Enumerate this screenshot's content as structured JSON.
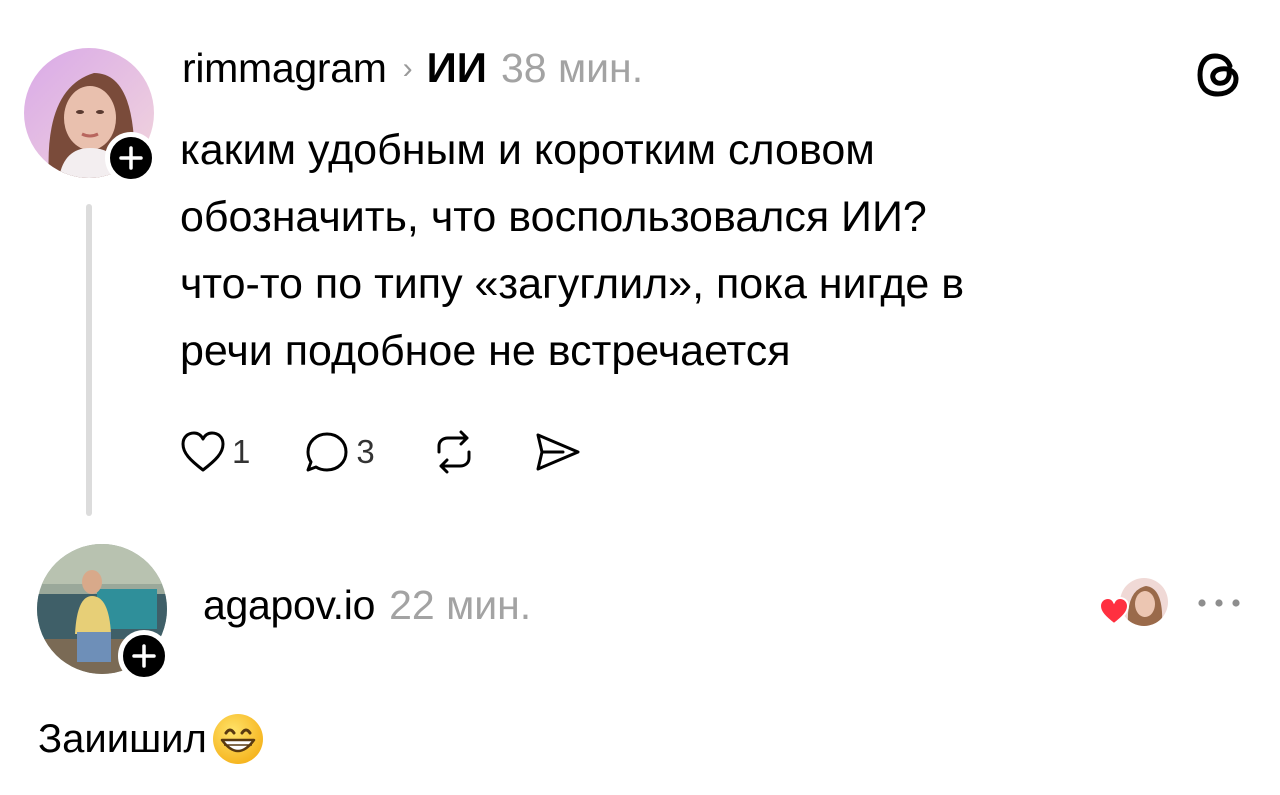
{
  "post": {
    "username": "rimmagram",
    "topic": "ИИ",
    "time": "38 мин.",
    "lines": [
      "каким удобным и коротким словом",
      "обозначить, что воспользовался ИИ?",
      "что-то по типу «загуглил», пока нигде в",
      "речи подобное не встречается"
    ],
    "likes": "1",
    "comments": "3"
  },
  "reply": {
    "username": "agapov.io",
    "time": "22 мин.",
    "text": "Заиишил"
  },
  "icons": {
    "app_logo": "threads-logo-icon",
    "like": "heart-icon",
    "comment": "comment-bubble-icon",
    "repost": "repost-icon",
    "share": "send-icon",
    "more": "more-dots-icon",
    "liked_by_author": "author-liked-heart-icon",
    "emoji": "grinning-emoji-icon"
  },
  "colors": {
    "text": "#000000",
    "muted": "#a3a3a3",
    "thread_line": "#dcdcdc",
    "heart": "#ff3040"
  }
}
